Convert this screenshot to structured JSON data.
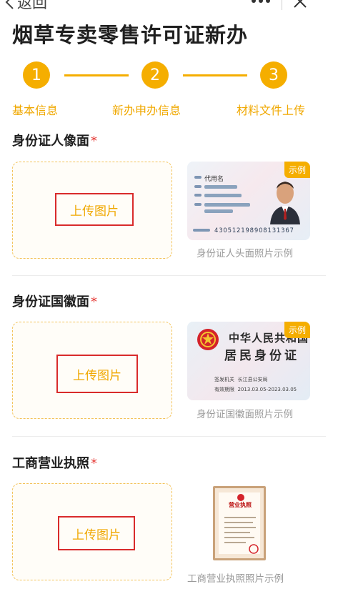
{
  "header": {
    "back_label": "返回",
    "more_icon": "more-dots-icon",
    "close_icon": "close-icon"
  },
  "page_title": "烟草专卖零售许可证新办",
  "steps": [
    {
      "number": "1",
      "label": "基本信息"
    },
    {
      "number": "2",
      "label": "新办申办信息"
    },
    {
      "number": "3",
      "label": "材料文件上传"
    }
  ],
  "sections": [
    {
      "title": "身份证人像面",
      "required_mark": "*",
      "upload_label": "上传图片",
      "sample_tag": "示例",
      "sample_caption": "身份证人头面照片示例",
      "sample_text": {
        "name": "代用名",
        "number": "430512198908131367"
      }
    },
    {
      "title": "身份证国徽面",
      "required_mark": "*",
      "upload_label": "上传图片",
      "sample_tag": "示例",
      "sample_caption": "身份证国徽面照片示例",
      "sample_text": {
        "line1": "中华人民共和国",
        "line2": "居民身份证",
        "authority_label": "签发机关",
        "authority_value": "长江县公安局",
        "validity_label": "有效期限",
        "validity_value": "2013.03.05-2023.03.05"
      }
    },
    {
      "title": "工商营业执照",
      "required_mark": "*",
      "upload_label": "上传图片",
      "sample_caption": "工商营业执照照片示例",
      "sample_text": {
        "title": "营业执照"
      }
    }
  ],
  "colors": {
    "accent": "#f5ae00",
    "required": "#e53935",
    "highlight_border": "#d92b2b"
  }
}
